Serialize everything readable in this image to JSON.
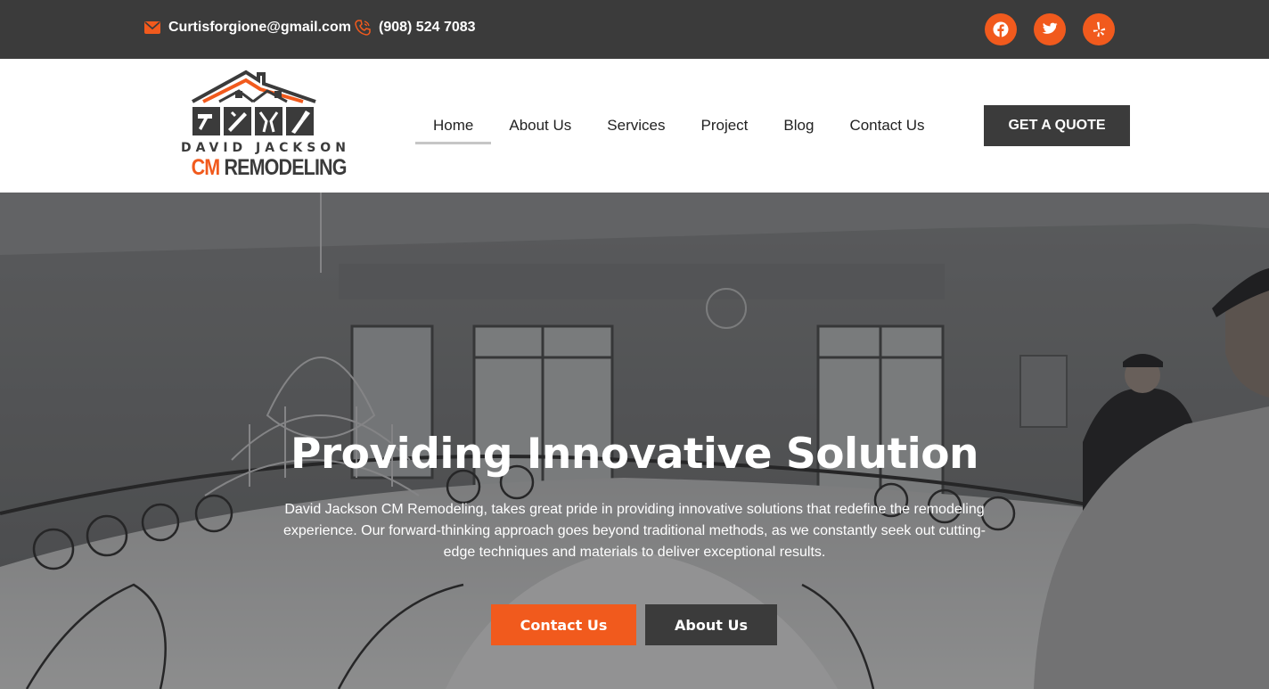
{
  "topbar": {
    "email": "Curtisforgione@gmail.com",
    "phone": "(908) 524 7083",
    "icons": {
      "email": "envelope-icon",
      "phone": "phone-icon"
    },
    "socials": [
      {
        "name": "facebook",
        "icon": "facebook-icon"
      },
      {
        "name": "twitter",
        "icon": "twitter-icon"
      },
      {
        "name": "yelp",
        "icon": "yelp-icon"
      }
    ]
  },
  "logo": {
    "line1": "DAVID JACKSON",
    "line2_accent": "CM",
    "line2_rest": "REMODELING"
  },
  "nav": {
    "items": [
      {
        "label": "Home",
        "active": true
      },
      {
        "label": "About Us",
        "active": false
      },
      {
        "label": "Services",
        "active": false
      },
      {
        "label": "Project",
        "active": false
      },
      {
        "label": "Blog",
        "active": false
      },
      {
        "label": "Contact Us",
        "active": false
      }
    ],
    "cta": "GET A QUOTE"
  },
  "hero": {
    "title": "Providing Innovative Solution",
    "text": "David Jackson CM Remodeling, takes great pride in providing innovative solutions that redefine the remodeling experience. Our forward-thinking approach goes beyond traditional methods, as we constantly seek out cutting-edge techniques and materials to deliver exceptional results.",
    "primary_button": "Contact Us",
    "secondary_button": "About Us"
  },
  "colors": {
    "accent": "#f15a1d",
    "dark": "#3b3b3b",
    "white": "#ffffff"
  }
}
